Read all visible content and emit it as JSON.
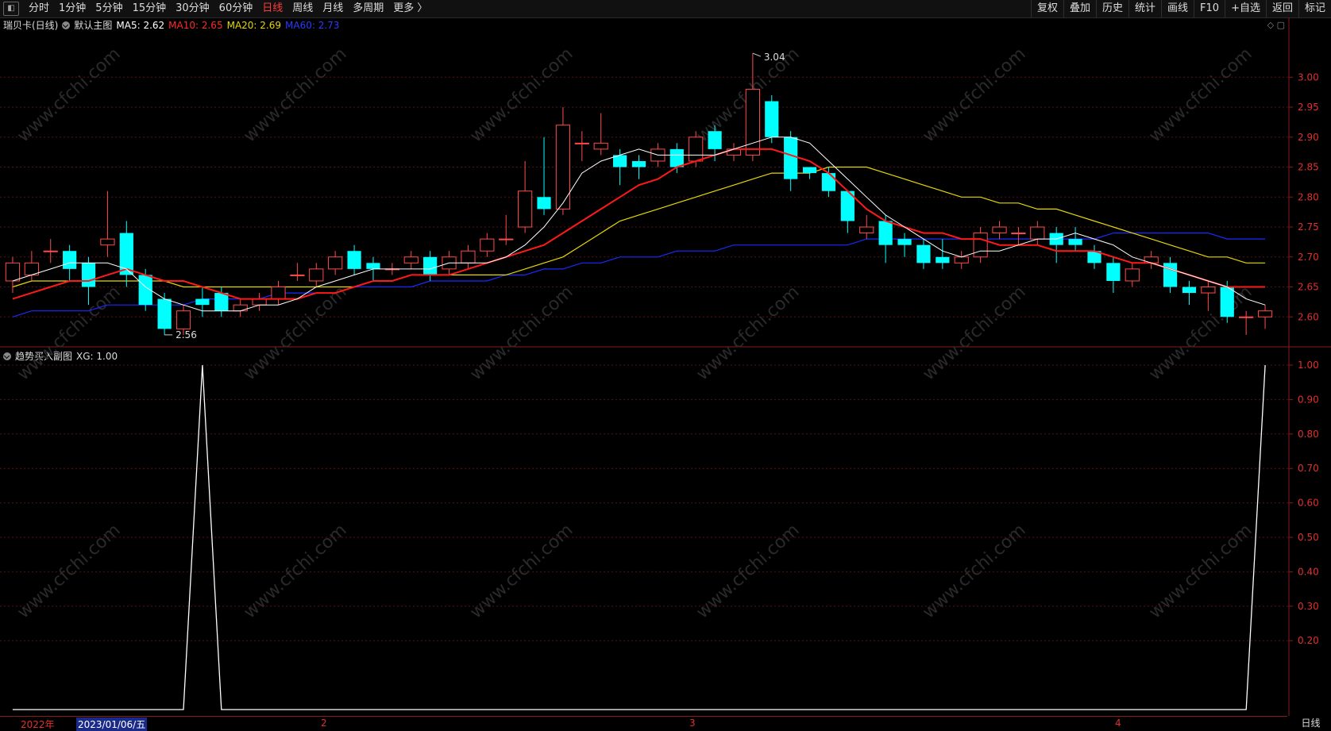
{
  "topbar": {
    "periods": [
      "分时",
      "1分钟",
      "5分钟",
      "15分钟",
      "30分钟",
      "60分钟",
      "日线",
      "周线",
      "月线",
      "多周期",
      "更多 〉"
    ],
    "active_period": "日线",
    "tools": [
      "复权",
      "叠加",
      "历史",
      "统计",
      "画线",
      "F10",
      "+自选",
      "返回",
      "标记"
    ]
  },
  "main_legend": {
    "stock": "瑞贝卡(日线)",
    "indicator": "默认主图",
    "ma5": "MA5: 2.62",
    "ma10": "MA10: 2.65",
    "ma20": "MA20: 2.69",
    "ma60": "MA60: 2.73"
  },
  "sub_legend": {
    "name": "趋势买入副图",
    "value": "XG: 1.00"
  },
  "price_axis": [
    "3.00",
    "2.95",
    "2.90",
    "2.85",
    "2.80",
    "2.75",
    "2.70",
    "2.65",
    "2.60"
  ],
  "sub_axis": [
    "1.00",
    "0.90",
    "0.80",
    "0.70",
    "0.60",
    "0.50",
    "0.40",
    "0.30",
    "0.20"
  ],
  "annotations": {
    "high": "3.04",
    "low": "2.56"
  },
  "date_axis": {
    "year": "2022年",
    "selected": "2023/01/06/五",
    "months": [
      "2",
      "3",
      "4"
    ]
  },
  "corner_label": "日线",
  "watermark": "www.cfchi.com",
  "colors": {
    "up": "#ff4b4b",
    "down": "#00ffff",
    "ma5": "#ffffff",
    "ma10": "#ff1a1a",
    "ma20": "#e6d800",
    "ma60": "#1a2aff"
  },
  "chart_data": {
    "type": "candlestick",
    "price_range": [
      2.55,
      3.06
    ],
    "candles": [
      [
        2.66,
        2.69,
        2.7,
        2.64
      ],
      [
        2.67,
        2.69,
        2.71,
        2.66
      ],
      [
        2.71,
        2.71,
        2.73,
        2.69
      ],
      [
        2.71,
        2.68,
        2.72,
        2.66
      ],
      [
        2.69,
        2.65,
        2.7,
        2.62
      ],
      [
        2.72,
        2.73,
        2.81,
        2.7
      ],
      [
        2.74,
        2.67,
        2.76,
        2.65
      ],
      [
        2.67,
        2.62,
        2.68,
        2.61
      ],
      [
        2.63,
        2.58,
        2.64,
        2.57
      ],
      [
        2.58,
        2.61,
        2.62,
        2.57
      ],
      [
        2.63,
        2.62,
        2.65,
        2.6
      ],
      [
        2.64,
        2.61,
        2.65,
        2.6
      ],
      [
        2.61,
        2.62,
        2.63,
        2.6
      ],
      [
        2.62,
        2.63,
        2.64,
        2.61
      ],
      [
        2.63,
        2.65,
        2.66,
        2.62
      ],
      [
        2.67,
        2.67,
        2.69,
        2.66
      ],
      [
        2.66,
        2.68,
        2.69,
        2.65
      ],
      [
        2.68,
        2.7,
        2.71,
        2.67
      ],
      [
        2.71,
        2.68,
        2.72,
        2.67
      ],
      [
        2.69,
        2.68,
        2.7,
        2.66
      ],
      [
        2.68,
        2.68,
        2.69,
        2.67
      ],
      [
        2.69,
        2.7,
        2.71,
        2.68
      ],
      [
        2.7,
        2.67,
        2.71,
        2.66
      ],
      [
        2.68,
        2.7,
        2.71,
        2.67
      ],
      [
        2.69,
        2.71,
        2.72,
        2.68
      ],
      [
        2.71,
        2.73,
        2.74,
        2.7
      ],
      [
        2.73,
        2.73,
        2.77,
        2.72
      ],
      [
        2.75,
        2.81,
        2.86,
        2.74
      ],
      [
        2.8,
        2.78,
        2.9,
        2.77
      ],
      [
        2.78,
        2.92,
        2.95,
        2.77
      ],
      [
        2.89,
        2.89,
        2.91,
        2.86
      ],
      [
        2.88,
        2.89,
        2.94,
        2.87
      ],
      [
        2.87,
        2.85,
        2.88,
        2.82
      ],
      [
        2.86,
        2.85,
        2.87,
        2.83
      ],
      [
        2.86,
        2.88,
        2.89,
        2.85
      ],
      [
        2.88,
        2.85,
        2.89,
        2.84
      ],
      [
        2.86,
        2.9,
        2.91,
        2.85
      ],
      [
        2.91,
        2.88,
        2.92,
        2.86
      ],
      [
        2.87,
        2.88,
        2.89,
        2.86
      ],
      [
        2.87,
        2.98,
        3.04,
        2.86
      ],
      [
        2.96,
        2.9,
        2.97,
        2.89
      ],
      [
        2.9,
        2.83,
        2.91,
        2.81
      ],
      [
        2.85,
        2.84,
        2.85,
        2.83
      ],
      [
        2.84,
        2.81,
        2.85,
        2.8
      ],
      [
        2.81,
        2.76,
        2.81,
        2.74
      ],
      [
        2.74,
        2.75,
        2.77,
        2.73
      ],
      [
        2.76,
        2.72,
        2.77,
        2.69
      ],
      [
        2.73,
        2.72,
        2.74,
        2.7
      ],
      [
        2.72,
        2.69,
        2.73,
        2.68
      ],
      [
        2.7,
        2.69,
        2.73,
        2.68
      ],
      [
        2.69,
        2.7,
        2.71,
        2.68
      ],
      [
        2.7,
        2.74,
        2.75,
        2.69
      ],
      [
        2.74,
        2.75,
        2.76,
        2.73
      ],
      [
        2.74,
        2.74,
        2.75,
        2.72
      ],
      [
        2.73,
        2.75,
        2.76,
        2.72
      ],
      [
        2.74,
        2.72,
        2.75,
        2.69
      ],
      [
        2.73,
        2.72,
        2.75,
        2.71
      ],
      [
        2.71,
        2.69,
        2.72,
        2.68
      ],
      [
        2.69,
        2.66,
        2.7,
        2.64
      ],
      [
        2.66,
        2.68,
        2.69,
        2.65
      ],
      [
        2.69,
        2.7,
        2.71,
        2.68
      ],
      [
        2.69,
        2.65,
        2.7,
        2.64
      ],
      [
        2.65,
        2.64,
        2.66,
        2.62
      ],
      [
        2.64,
        2.65,
        2.66,
        2.61
      ],
      [
        2.65,
        2.6,
        2.66,
        2.59
      ],
      [
        2.6,
        2.6,
        2.61,
        2.57
      ],
      [
        2.6,
        2.61,
        2.62,
        2.58
      ]
    ],
    "ma5": [
      2.66,
      2.67,
      2.68,
      2.69,
      2.69,
      2.69,
      2.68,
      2.65,
      2.63,
      2.62,
      2.61,
      2.61,
      2.61,
      2.62,
      2.62,
      2.63,
      2.65,
      2.66,
      2.67,
      2.68,
      2.68,
      2.68,
      2.68,
      2.69,
      2.69,
      2.69,
      2.7,
      2.72,
      2.75,
      2.79,
      2.84,
      2.86,
      2.87,
      2.88,
      2.87,
      2.87,
      2.87,
      2.87,
      2.88,
      2.89,
      2.9,
      2.9,
      2.89,
      2.86,
      2.83,
      2.8,
      2.77,
      2.75,
      2.73,
      2.71,
      2.7,
      2.71,
      2.71,
      2.72,
      2.73,
      2.73,
      2.74,
      2.73,
      2.72,
      2.7,
      2.69,
      2.68,
      2.67,
      2.66,
      2.65,
      2.63,
      2.62
    ],
    "ma10": [
      2.63,
      2.64,
      2.65,
      2.66,
      2.66,
      2.67,
      2.68,
      2.67,
      2.66,
      2.66,
      2.65,
      2.64,
      2.63,
      2.63,
      2.63,
      2.63,
      2.64,
      2.64,
      2.65,
      2.66,
      2.66,
      2.67,
      2.67,
      2.67,
      2.68,
      2.69,
      2.7,
      2.71,
      2.72,
      2.74,
      2.76,
      2.78,
      2.8,
      2.82,
      2.83,
      2.85,
      2.86,
      2.87,
      2.88,
      2.88,
      2.88,
      2.87,
      2.86,
      2.84,
      2.81,
      2.78,
      2.76,
      2.75,
      2.74,
      2.74,
      2.73,
      2.73,
      2.72,
      2.72,
      2.72,
      2.71,
      2.71,
      2.71,
      2.7,
      2.69,
      2.69,
      2.68,
      2.67,
      2.66,
      2.65,
      2.65,
      2.65
    ],
    "ma20": [
      2.65,
      2.66,
      2.66,
      2.66,
      2.66,
      2.66,
      2.66,
      2.66,
      2.66,
      2.65,
      2.65,
      2.65,
      2.65,
      2.65,
      2.65,
      2.65,
      2.65,
      2.65,
      2.65,
      2.66,
      2.66,
      2.67,
      2.67,
      2.67,
      2.67,
      2.67,
      2.67,
      2.68,
      2.69,
      2.7,
      2.72,
      2.74,
      2.76,
      2.77,
      2.78,
      2.79,
      2.8,
      2.81,
      2.82,
      2.83,
      2.84,
      2.84,
      2.84,
      2.85,
      2.85,
      2.85,
      2.84,
      2.83,
      2.82,
      2.81,
      2.8,
      2.8,
      2.79,
      2.79,
      2.78,
      2.78,
      2.77,
      2.76,
      2.75,
      2.74,
      2.73,
      2.72,
      2.71,
      2.7,
      2.7,
      2.69,
      2.69
    ],
    "ma60": [
      2.6,
      2.61,
      2.61,
      2.61,
      2.61,
      2.62,
      2.62,
      2.62,
      2.62,
      2.62,
      2.63,
      2.63,
      2.63,
      2.63,
      2.64,
      2.64,
      2.64,
      2.64,
      2.65,
      2.65,
      2.65,
      2.65,
      2.66,
      2.66,
      2.66,
      2.66,
      2.67,
      2.67,
      2.68,
      2.68,
      2.69,
      2.69,
      2.7,
      2.7,
      2.7,
      2.71,
      2.71,
      2.71,
      2.72,
      2.72,
      2.72,
      2.72,
      2.72,
      2.72,
      2.72,
      2.73,
      2.73,
      2.73,
      2.73,
      2.73,
      2.73,
      2.73,
      2.73,
      2.73,
      2.73,
      2.73,
      2.73,
      2.73,
      2.74,
      2.74,
      2.74,
      2.74,
      2.74,
      2.74,
      2.73,
      2.73,
      2.73
    ],
    "xg": [
      0,
      0,
      0,
      0,
      0,
      0,
      0,
      0,
      0,
      0,
      1,
      0,
      0,
      0,
      0,
      0,
      0,
      0,
      0,
      0,
      0,
      0,
      0,
      0,
      0,
      0,
      0,
      0,
      0,
      0,
      0,
      0,
      0,
      0,
      0,
      0,
      0,
      0,
      0,
      0,
      0,
      0,
      0,
      0,
      0,
      0,
      0,
      0,
      0,
      0,
      0,
      0,
      0,
      0,
      0,
      0,
      0,
      0,
      0,
      0,
      0,
      0,
      0,
      0,
      0,
      0,
      1
    ],
    "sub_range": [
      0.0,
      1.0
    ]
  }
}
